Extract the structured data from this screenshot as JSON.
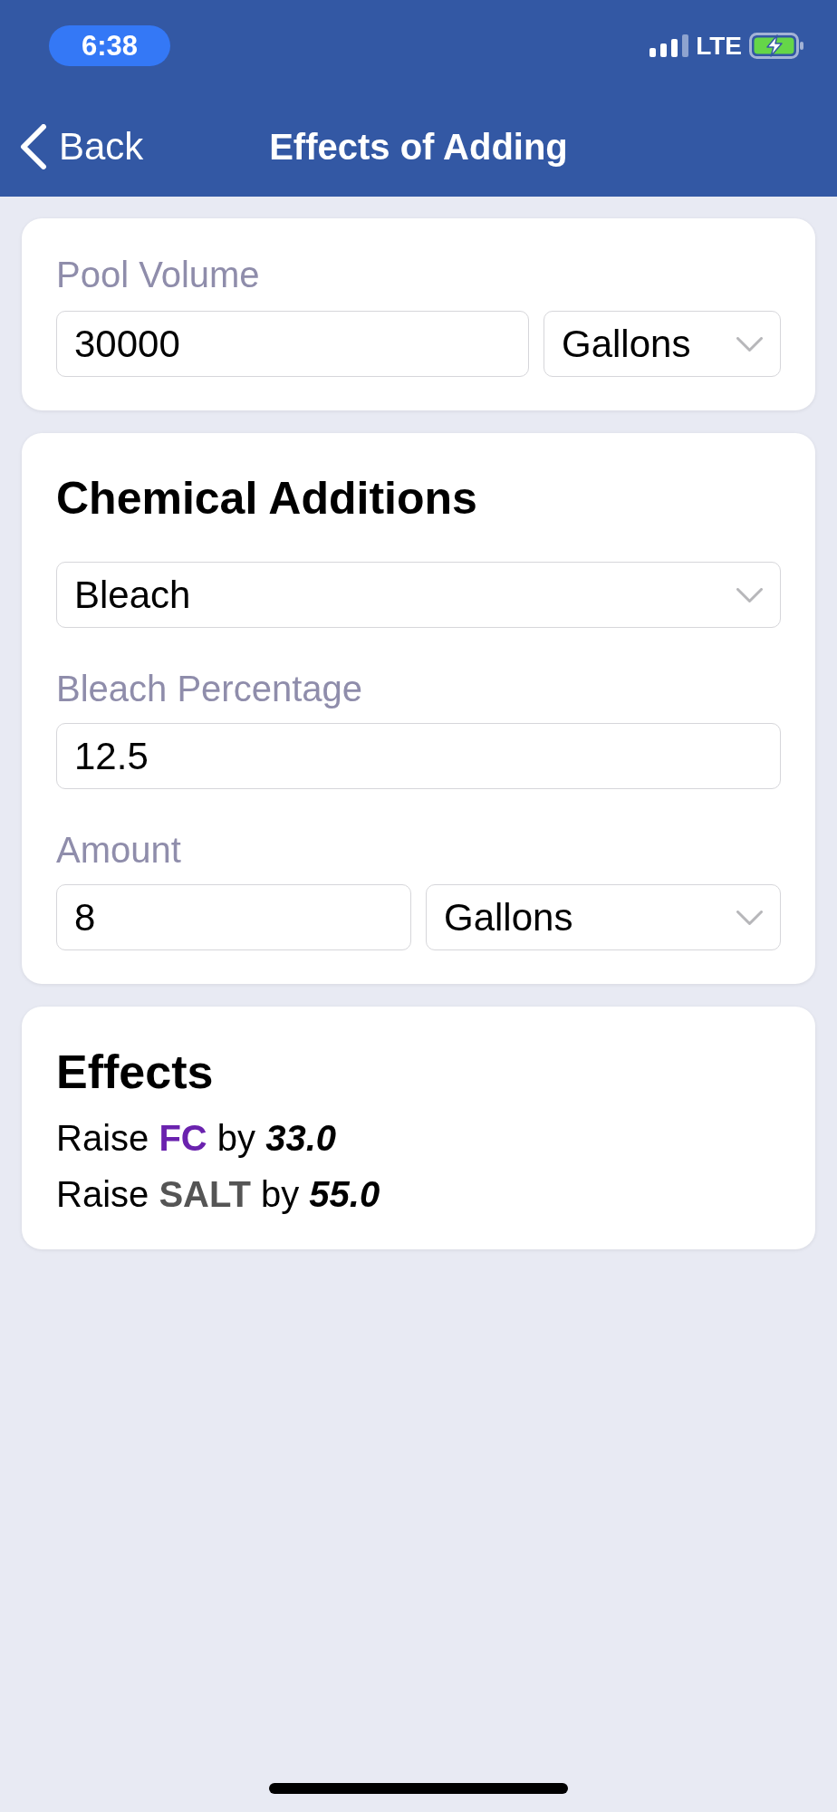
{
  "status_bar": {
    "time": "6:38",
    "network": "LTE",
    "charging": true
  },
  "nav": {
    "back": "Back",
    "title": "Effects of Adding"
  },
  "pool_volume": {
    "label": "Pool Volume",
    "value": "30000",
    "unit": "Gallons"
  },
  "chemical_additions": {
    "title": "Chemical Additions",
    "chemical": "Bleach",
    "percentage": {
      "label": "Bleach Percentage",
      "value": "12.5"
    },
    "amount": {
      "label": "Amount",
      "value": "8",
      "unit": "Gallons"
    }
  },
  "effects": {
    "title": "Effects",
    "items": [
      {
        "verb": "Raise",
        "parameter": "FC",
        "color": "#6a22ae",
        "connector": "by",
        "amount": "33.0"
      },
      {
        "verb": "Raise",
        "parameter": "SALT",
        "color": "#555555",
        "connector": "by",
        "amount": "55.0"
      }
    ]
  }
}
